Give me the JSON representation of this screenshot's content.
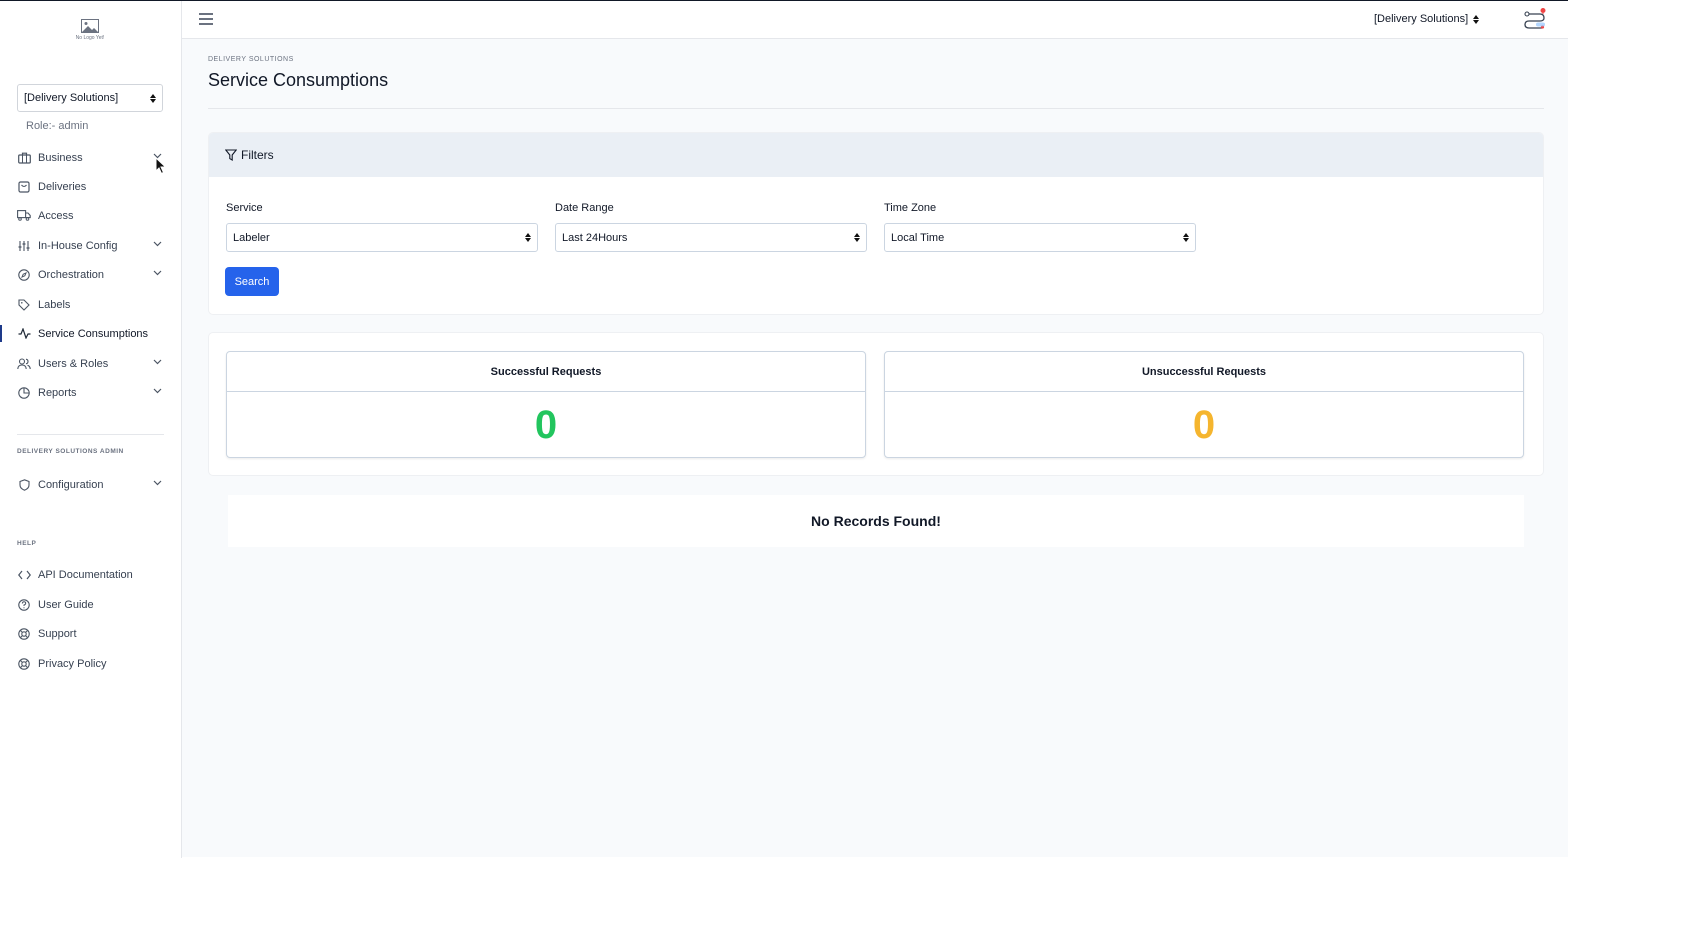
{
  "sidebar": {
    "logo_text": "No Logo Yet!",
    "org_select": "[Delivery Solutions]",
    "role": "Role:- admin",
    "items": [
      {
        "label": "Business",
        "icon": "briefcase-icon",
        "chevron": true
      },
      {
        "label": "Deliveries",
        "icon": "package-icon",
        "chevron": false
      },
      {
        "label": "Access",
        "icon": "truck-icon",
        "chevron": false
      },
      {
        "label": "In-House Config",
        "icon": "sliders-icon",
        "chevron": true
      },
      {
        "label": "Orchestration",
        "icon": "compass-icon",
        "chevron": true
      },
      {
        "label": "Labels",
        "icon": "tag-icon",
        "chevron": false
      },
      {
        "label": "Service Consumptions",
        "icon": "activity-icon",
        "chevron": false
      },
      {
        "label": "Users & Roles",
        "icon": "users-icon",
        "chevron": true
      },
      {
        "label": "Reports",
        "icon": "pie-chart-icon",
        "chevron": true
      }
    ],
    "admin_section_label": "DELIVERY SOLUTIONS ADMIN",
    "admin_items": [
      {
        "label": "Configuration",
        "icon": "shield-icon",
        "chevron": true
      }
    ],
    "help_section_label": "HELP",
    "help_items": [
      {
        "label": "API Documentation",
        "icon": "code-icon"
      },
      {
        "label": "User Guide",
        "icon": "help-circle-icon"
      },
      {
        "label": "Support",
        "icon": "life-buoy-icon"
      },
      {
        "label": "Privacy Policy",
        "icon": "life-buoy-icon"
      }
    ]
  },
  "topbar": {
    "org_label": "[Delivery Solutions]"
  },
  "main": {
    "breadcrumb": "DELIVERY SOLUTIONS",
    "title": "Service Consumptions",
    "filters": {
      "title": "Filters",
      "service_label": "Service",
      "service_value": "Labeler",
      "date_range_label": "Date Range",
      "date_range_value": "Last 24Hours",
      "time_zone_label": "Time Zone",
      "time_zone_value": "Local Time",
      "search_label": "Search"
    },
    "stats": {
      "successful_title": "Successful Requests",
      "successful_value": "0",
      "unsuccessful_title": "Unsuccessful Requests",
      "unsuccessful_value": "0"
    },
    "no_records": "No Records Found!"
  },
  "colors": {
    "primary": "#2563eb",
    "success": "#22c55e",
    "warning": "#f5b52e",
    "active_indicator": "#1e3a8a"
  }
}
